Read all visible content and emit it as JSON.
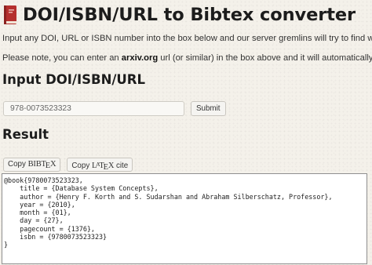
{
  "header": {
    "title": "DOI/ISBN/URL to Bibtex converter",
    "icon": "book-icon"
  },
  "intro": {
    "line1": "Input any DOI, URL or ISBN number into the box below and our server gremlins will try to find w",
    "line2_prefix": "Please note, you can enter an ",
    "line2_bold": "arxiv.org",
    "line2_suffix": " url (or similar) in the box above and it will automatically"
  },
  "input_section": {
    "heading": "Input DOI/ISBN/URL",
    "input_value": "978-0073523323",
    "submit_label": "Submit"
  },
  "result_section": {
    "heading": "Result",
    "copy_bibtex_prefix": "Copy",
    "copy_latex_prefix": "Copy",
    "copy_latex_suffix": "cite",
    "bibtex_text": "@book{9780073523323,\n    title = {Database System Concepts},\n    author = {Henry F. Korth and S. Sudarshan and Abraham Silberschatz, Professor},\n    year = {2010},\n    month = {01},\n    day = {27},\n    pagecount = {1376},\n    isbn = {9780073523323}\n}"
  },
  "colors": {
    "background": "#f4f1ea",
    "icon_red": "#b5302e"
  }
}
